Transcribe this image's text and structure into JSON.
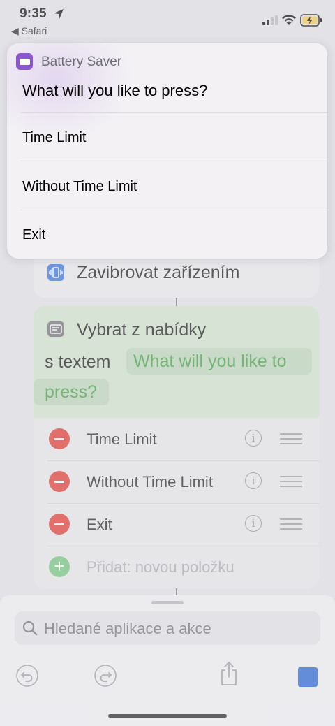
{
  "status_bar": {
    "time": "9:35",
    "back_label": "◀ Safari",
    "icons": [
      "location-arrow-icon",
      "cellular-signal-icon",
      "wifi-icon",
      "battery-charging-icon"
    ]
  },
  "canvas": {
    "vibrate_action": {
      "icon": "vibrate-phone-icon",
      "title": "Zavibrovat zařízením"
    },
    "choose_from_menu": {
      "icon": "menu-card-icon",
      "title": "Vybrat z nabídky",
      "prefix": "s textem",
      "prompt_line1": "What will you like to",
      "prompt_line2": "press?",
      "items": [
        {
          "label": "Time Limit"
        },
        {
          "label": "Without Time Limit"
        },
        {
          "label": "Exit"
        }
      ],
      "add_item_label": "Přidat: novou položku",
      "info_glyph": "i"
    }
  },
  "bottom_panel": {
    "search_placeholder": "Hledané aplikace a akce",
    "toolbar_icons": [
      "undo-icon",
      "redo-icon",
      "share-icon",
      "run-stop-icon"
    ],
    "colors": {
      "stop_button": "#1f5ed3"
    }
  },
  "alert": {
    "app_name": "Battery Saver",
    "app_icon": "battery-saver-icon",
    "question": "What will you like to press?",
    "options": [
      "Time Limit",
      "Without Time Limit",
      "Exit"
    ],
    "colors": {
      "app_icon": "#8b57d0"
    }
  }
}
